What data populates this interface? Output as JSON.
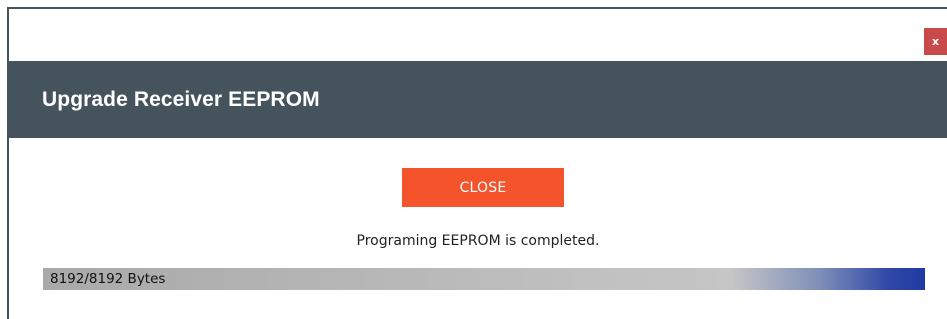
{
  "window": {
    "title": "Upgrade Receiver EEPROM",
    "close_glyph": "x",
    "close_color": "#c94a4a",
    "header_color": "#45535c"
  },
  "actions": {
    "close_label": "CLOSE",
    "close_color": "#f4532c"
  },
  "status": {
    "message": "Programing EEPROM is completed."
  },
  "progress": {
    "label": "8192/8192 Bytes",
    "current": 8192,
    "total": 8192,
    "fraction": 1.0
  }
}
